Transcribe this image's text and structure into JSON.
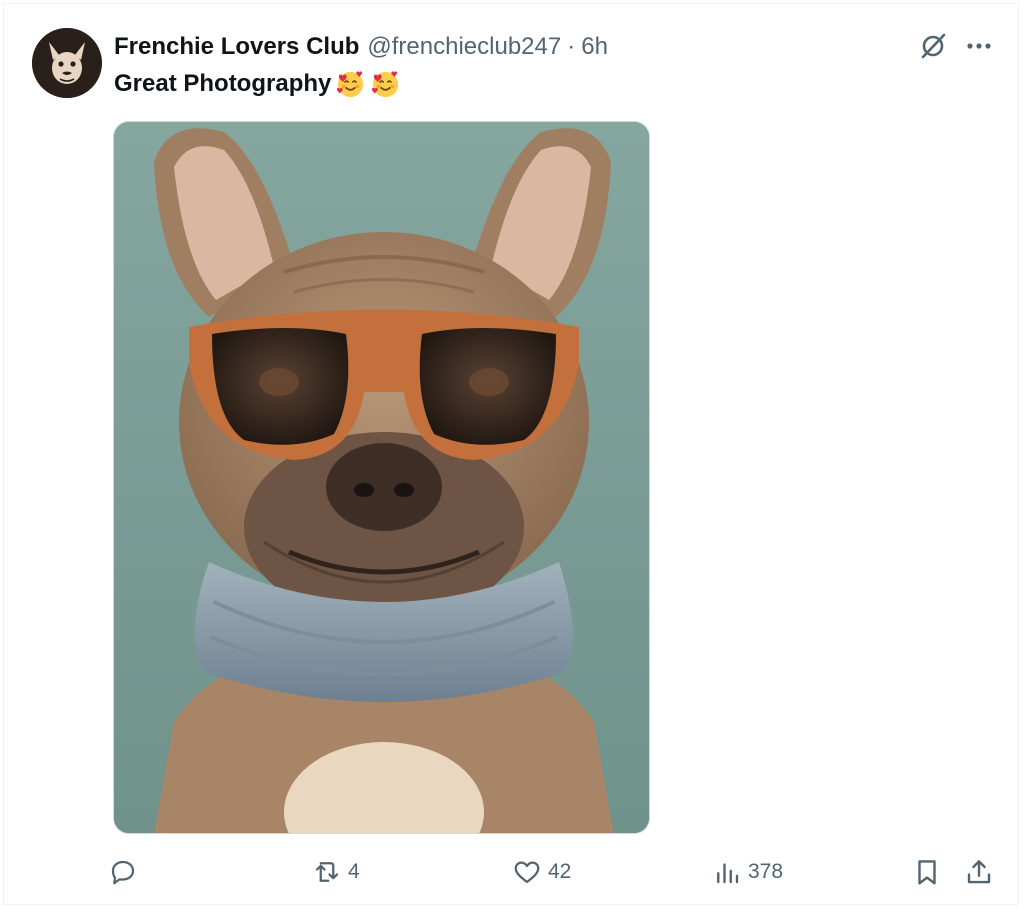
{
  "tweet": {
    "author_name": "Frenchie Lovers Club",
    "handle": "@frenchieclub247",
    "separator": "·",
    "time": "6h",
    "text": "Great Photography",
    "emoji": [
      "smiling-face-with-hearts",
      "smiling-face-with-hearts"
    ],
    "media_alt": "French bulldog wearing orange sunglasses and a grey scarf"
  },
  "actions": {
    "reply_count": "",
    "retweet_count": "4",
    "like_count": "42",
    "views_count": "378"
  },
  "colors": {
    "text_primary": "#0f1419",
    "text_secondary": "#536471",
    "image_background": "#7a9c95"
  }
}
